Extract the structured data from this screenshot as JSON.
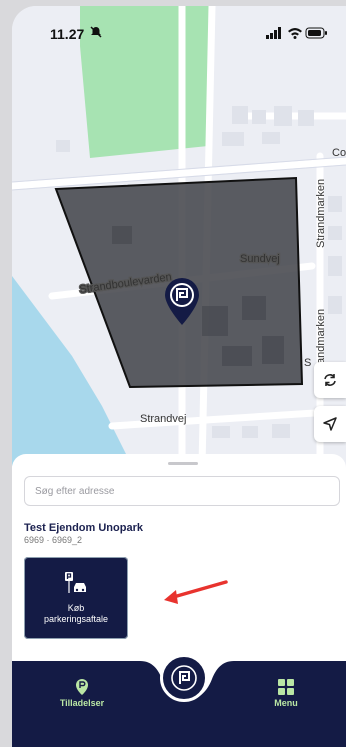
{
  "status_bar": {
    "time": "11.27"
  },
  "map": {
    "labels": {
      "strandboulevarden": "Strandboulevarden",
      "sundvej": "Sundvej",
      "strandvej": "Strandvej",
      "strandmarken": "Strandmarken",
      "strandmarken2": "Strandmarken",
      "co": "Co",
      "fragment_s": "S"
    }
  },
  "map_controls": [
    {
      "icon": "refresh-icon"
    },
    {
      "icon": "location-arrow-icon"
    }
  ],
  "sheet": {
    "search_placeholder": "Søg efter adresse",
    "property_name": "Test Ejendom Unopark",
    "property_id": "6969 · 6969_2",
    "action_tile": {
      "label_line1": "Køb",
      "label_line2": "parkeringsaftale",
      "icon": "parking-car-icon"
    }
  },
  "bottom_nav": {
    "left": {
      "label": "Tilladelser",
      "icon": "permit-pin-icon"
    },
    "center": {
      "icon": "parking-logo-icon"
    },
    "right": {
      "label": "Menu",
      "icon": "grid-menu-icon"
    }
  },
  "colors": {
    "navy": "#141b45",
    "accent_green": "#b9e6a4",
    "arrow_red": "#e8332e",
    "water": "#a8d8ec",
    "park": "#a7e3b2"
  }
}
